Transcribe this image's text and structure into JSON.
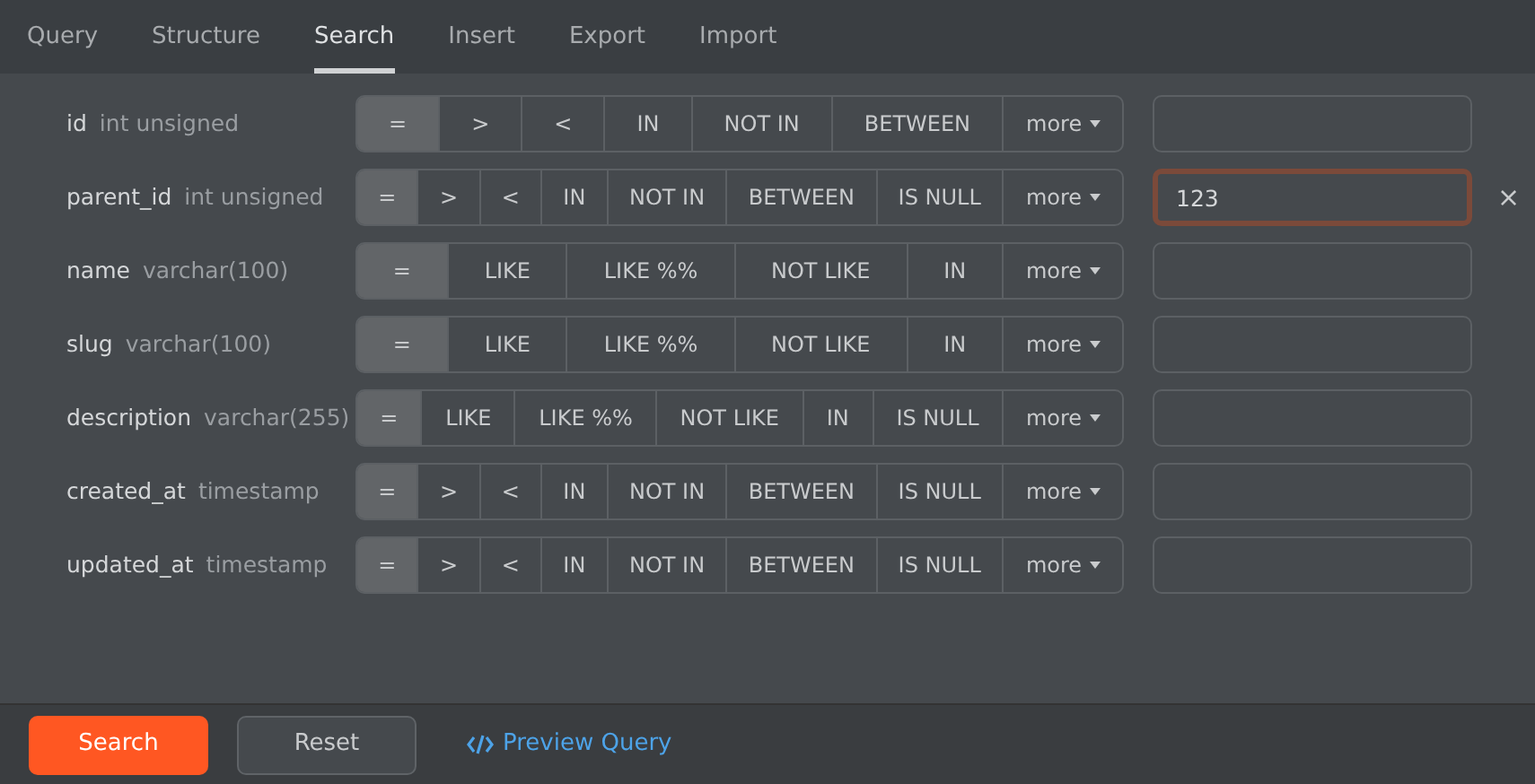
{
  "tabs": [
    {
      "label": "Query",
      "selected": false
    },
    {
      "label": "Structure",
      "selected": false
    },
    {
      "label": "Search",
      "selected": true
    },
    {
      "label": "Insert",
      "selected": false
    },
    {
      "label": "Export",
      "selected": false
    },
    {
      "label": "Import",
      "selected": false
    }
  ],
  "fields": [
    {
      "name": "id",
      "type": "int unsigned",
      "operators": [
        {
          "label": "=",
          "selected": true
        },
        {
          "label": ">",
          "selected": false
        },
        {
          "label": "<",
          "selected": false
        },
        {
          "label": "IN",
          "selected": false
        },
        {
          "label": "NOT IN",
          "selected": false
        },
        {
          "label": "BETWEEN",
          "selected": false
        }
      ],
      "more": "more",
      "focused": false
    },
    {
      "name": "parent_id",
      "type": "int unsigned",
      "operators": [
        {
          "label": "=",
          "selected": true
        },
        {
          "label": ">",
          "selected": false
        },
        {
          "label": "<",
          "selected": false
        },
        {
          "label": "IN",
          "selected": false
        },
        {
          "label": "NOT IN",
          "selected": false
        },
        {
          "label": "BETWEEN",
          "selected": false
        },
        {
          "label": "IS NULL",
          "selected": false
        }
      ],
      "more": "more",
      "value": "123",
      "focused": true,
      "clear": "×"
    },
    {
      "name": "name",
      "type": "varchar(100)",
      "operators": [
        {
          "label": "=",
          "selected": true
        },
        {
          "label": "LIKE",
          "selected": false
        },
        {
          "label": "LIKE %%",
          "selected": false
        },
        {
          "label": "NOT LIKE",
          "selected": false
        },
        {
          "label": "IN",
          "selected": false
        }
      ],
      "more": "more",
      "focused": false
    },
    {
      "name": "slug",
      "type": "varchar(100)",
      "operators": [
        {
          "label": "=",
          "selected": true
        },
        {
          "label": "LIKE",
          "selected": false
        },
        {
          "label": "LIKE %%",
          "selected": false
        },
        {
          "label": "NOT LIKE",
          "selected": false
        },
        {
          "label": "IN",
          "selected": false
        }
      ],
      "more": "more",
      "focused": false
    },
    {
      "name": "description",
      "type": "varchar(255)",
      "operators": [
        {
          "label": "=",
          "selected": true
        },
        {
          "label": "LIKE",
          "selected": false
        },
        {
          "label": "LIKE %%",
          "selected": false
        },
        {
          "label": "NOT LIKE",
          "selected": false
        },
        {
          "label": "IN",
          "selected": false
        },
        {
          "label": "IS NULL",
          "selected": false
        }
      ],
      "more": "more",
      "focused": false
    },
    {
      "name": "created_at",
      "type": "timestamp",
      "operators": [
        {
          "label": "=",
          "selected": true
        },
        {
          "label": ">",
          "selected": false
        },
        {
          "label": "<",
          "selected": false
        },
        {
          "label": "IN",
          "selected": false
        },
        {
          "label": "NOT IN",
          "selected": false
        },
        {
          "label": "BETWEEN",
          "selected": false
        },
        {
          "label": "IS NULL",
          "selected": false
        }
      ],
      "more": "more",
      "focused": false
    },
    {
      "name": "updated_at",
      "type": "timestamp",
      "operators": [
        {
          "label": "=",
          "selected": true
        },
        {
          "label": ">",
          "selected": false
        },
        {
          "label": "<",
          "selected": false
        },
        {
          "label": "IN",
          "selected": false
        },
        {
          "label": "NOT IN",
          "selected": false
        },
        {
          "label": "BETWEEN",
          "selected": false
        },
        {
          "label": "IS NULL",
          "selected": false
        }
      ],
      "more": "more",
      "focused": false
    }
  ],
  "footer": {
    "search": "Search",
    "reset": "Reset",
    "preview": "Preview Query"
  }
}
